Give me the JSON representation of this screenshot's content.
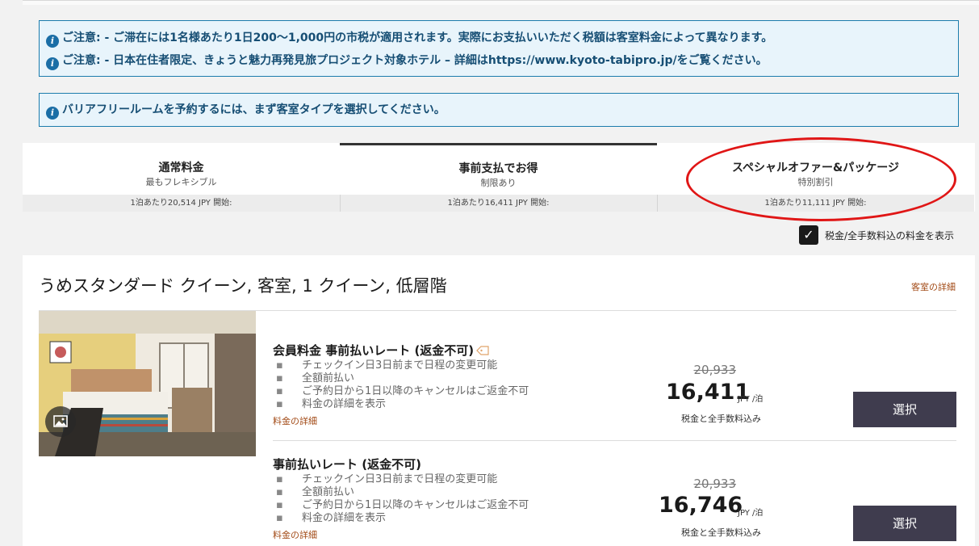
{
  "notices": {
    "tax_notice": "ご注意: - ご滞在には1名様あたり1日200～1,000円の市税が適用されます。実際にお支払いいただく税額は客室料金によって異なります。",
    "campaign_notice": "ご注意: - 日本在住者限定、きょうと魅力再発見旅プロジェクト対象ホテル – 詳細はhttps://www.kyoto-tabipro.jp/をご覧ください。",
    "accessible_notice": "バリアフリールームを予約するには、まず客室タイプを選択してください。",
    "info_icon_glyph": "i"
  },
  "rate_tabs": [
    {
      "title": "通常料金",
      "subtitle": "最もフレキシブル",
      "from_price": "1泊あたり20,514 JPY 開始:"
    },
    {
      "title": "事前支払でお得",
      "subtitle": "制限あり",
      "from_price": "1泊あたり16,411 JPY 開始:"
    },
    {
      "title": "スペシャルオファー&パッケージ",
      "subtitle": "特別割引",
      "from_price": "1泊あたり11,111 JPY 開始:"
    }
  ],
  "tax_toggle": {
    "label": "税金/全手数料込の料金を表示",
    "checked": true,
    "check_glyph": "✓"
  },
  "room": {
    "title": "うめスタンダード クイーン, 客室, 1 クイーン, 低層階",
    "details_link": "客室の詳細",
    "rates": [
      {
        "title": "会員料金 事前払いレート (返金不可)",
        "bullets": [
          "チェックイン日3日前まで日程の変更可能",
          "全額前払い",
          "ご予約日から1日以降のキャンセルはご返金不可",
          "料金の詳細を表示"
        ],
        "details_link": "料金の詳細",
        "old_price": "20,933",
        "price": "16,411",
        "unit": "JPY /泊",
        "tax_note": "税金と全手数料込み",
        "select_label": "選択"
      },
      {
        "title": "事前払いレート (返金不可)",
        "bullets": [
          "チェックイン日3日前まで日程の変更可能",
          "全額前払い",
          "ご予約日から1日以降のキャンセルはご返金不可",
          "料金の詳細を表示"
        ],
        "details_link": "料金の詳細",
        "old_price": "20,933",
        "price": "16,746",
        "unit": "JPY /泊",
        "tax_note": "税金と全手数料込み",
        "select_label": "選択"
      }
    ]
  },
  "colors": {
    "accent": "#e01616",
    "link": "#a24a16",
    "button": "#3f3c4e",
    "notice_border": "#1c7cad"
  }
}
